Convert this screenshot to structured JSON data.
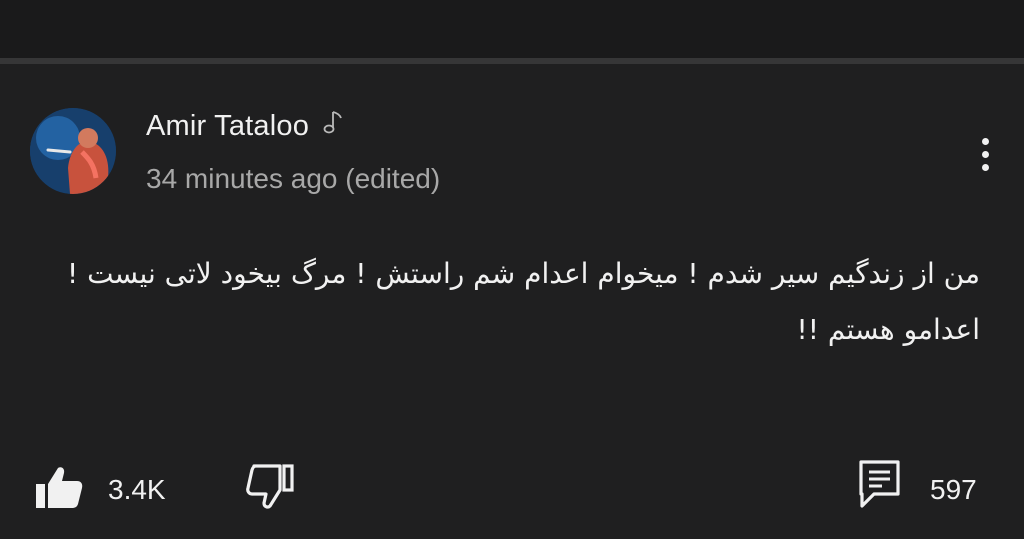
{
  "comment": {
    "author": {
      "name": "Amir Tataloo",
      "badge_icon": "music-note-icon",
      "avatar_icon": "profile-avatar"
    },
    "timestamp": "34 minutes ago (edited)",
    "body": "من از زندگیم سیر شدم ! میخوام اعدام شم راستش ! مرگ بیخود لاتی نیست ! اعدامو هستم !!",
    "menu_icon": "more-vertical-icon"
  },
  "actions": {
    "like": {
      "icon": "thumbs-up-icon",
      "count": "3.4K"
    },
    "dislike": {
      "icon": "thumbs-down-icon"
    },
    "replies": {
      "icon": "comment-icon",
      "count": "597"
    }
  },
  "colors": {
    "background": "#1f1f20",
    "separator": "#363637",
    "primary_text": "#f1f1f1",
    "secondary_text": "#a8a8a8"
  }
}
